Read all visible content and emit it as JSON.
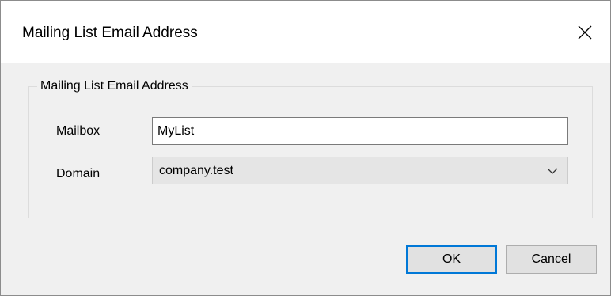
{
  "window": {
    "title": "Mailing List Email Address",
    "close_icon": "close-icon"
  },
  "group": {
    "legend": "Mailing List Email Address"
  },
  "mailbox": {
    "label": "Mailbox",
    "value": "MyList"
  },
  "domain": {
    "label": "Domain",
    "selected": "company.test",
    "arrow_icon": "chevron-down-icon"
  },
  "buttons": {
    "ok_label": "OK",
    "cancel_label": "Cancel"
  },
  "colors": {
    "default_button_border": "#0078d7",
    "dialog_background": "#f0f0f0",
    "titlebar_background": "#ffffff"
  }
}
